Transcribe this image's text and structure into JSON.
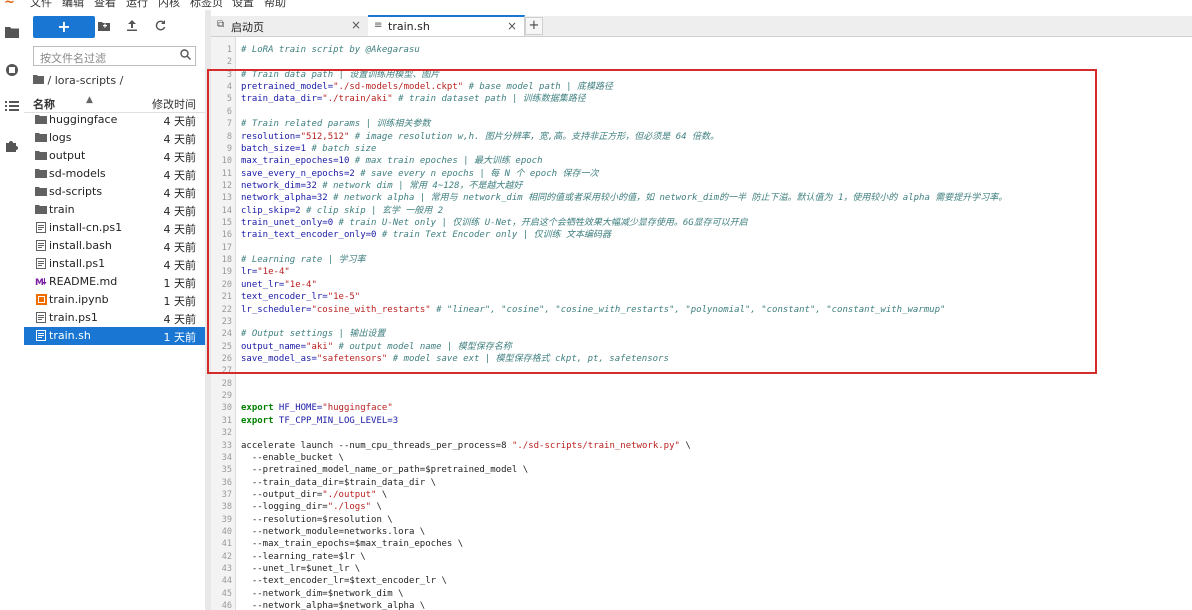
{
  "menu": [
    "文件",
    "编辑",
    "查看",
    "运行",
    "内核",
    "标签页",
    "设置",
    "帮助"
  ],
  "toolbar": {
    "new_label": "+"
  },
  "filter": {
    "placeholder": "按文件名过滤"
  },
  "breadcrumb": "/ lora-scripts /",
  "list_header": {
    "name": "名称",
    "modified": "修改时间"
  },
  "files": [
    {
      "name": "huggingface",
      "date": "4 天前",
      "kind": "folder"
    },
    {
      "name": "logs",
      "date": "4 天前",
      "kind": "folder"
    },
    {
      "name": "output",
      "date": "4 天前",
      "kind": "folder"
    },
    {
      "name": "sd-models",
      "date": "4 天前",
      "kind": "folder"
    },
    {
      "name": "sd-scripts",
      "date": "4 天前",
      "kind": "folder"
    },
    {
      "name": "train",
      "date": "4 天前",
      "kind": "folder"
    },
    {
      "name": "install-cn.ps1",
      "date": "4 天前",
      "kind": "file"
    },
    {
      "name": "install.bash",
      "date": "4 天前",
      "kind": "file"
    },
    {
      "name": "install.ps1",
      "date": "4 天前",
      "kind": "file"
    },
    {
      "name": "README.md",
      "date": "1 天前",
      "kind": "markdown"
    },
    {
      "name": "train.ipynb",
      "date": "1 天前",
      "kind": "notebook"
    },
    {
      "name": "train.ps1",
      "date": "4 天前",
      "kind": "file"
    },
    {
      "name": "train.sh",
      "date": "1 天前",
      "kind": "file",
      "selected": true
    }
  ],
  "tabs": [
    {
      "label": "启动页",
      "icon": "launcher-icon",
      "active": false
    },
    {
      "label": "train.sh",
      "icon": "text-file-icon",
      "active": true
    }
  ],
  "highlight_color": "#d62b2b",
  "accent_color": "#1976d2",
  "code_lines": [
    [
      [
        "cmt",
        "# LoRA train script by @Akegarasu"
      ]
    ],
    [],
    [
      [
        "cmt",
        "# Train data path | 设置训练用模型、图片"
      ]
    ],
    [
      [
        "var",
        "pretrained_model="
      ],
      [
        "str",
        "\"./sd-models/model.ckpt\""
      ],
      [
        "cmt",
        " # base model path | 底模路径"
      ]
    ],
    [
      [
        "var",
        "train_data_dir="
      ],
      [
        "str",
        "\"./train/aki\""
      ],
      [
        "cmt",
        " # train dataset path | 训练数据集路径"
      ]
    ],
    [],
    [
      [
        "cmt",
        "# Train related params | 训练相关参数"
      ]
    ],
    [
      [
        "var",
        "resolution="
      ],
      [
        "str",
        "\"512,512\""
      ],
      [
        "cmt",
        " # image resolution w,h. 图片分辨率，宽,高。支持非正方形，但必须是 64 倍数。"
      ]
    ],
    [
      [
        "var",
        "batch_size=1"
      ],
      [
        "cmt",
        " # batch size"
      ]
    ],
    [
      [
        "var",
        "max_train_epoches=10"
      ],
      [
        "cmt",
        " # max train epoches | 最大训练 epoch"
      ]
    ],
    [
      [
        "var",
        "save_every_n_epochs=2"
      ],
      [
        "cmt",
        " # save every n epochs | 每 N 个 epoch 保存一次"
      ]
    ],
    [
      [
        "var",
        "network_dim=32"
      ],
      [
        "cmt",
        " # network dim | 常用 4~128，不是越大越好"
      ]
    ],
    [
      [
        "var",
        "network_alpha=32"
      ],
      [
        "cmt",
        " # network alpha | 常用与 network_dim 相同的值或者采用较小的值，如 network_dim的一半 防止下溢。默认值为 1，使用较小的 alpha 需要提升学习率。"
      ]
    ],
    [
      [
        "var",
        "clip_skip=2"
      ],
      [
        "cmt",
        " # clip skip | 玄学 一般用 2"
      ]
    ],
    [
      [
        "var",
        "train_unet_only=0"
      ],
      [
        "cmt",
        " # train U-Net only | 仅训练 U-Net，开启这个会牺牲效果大幅减少显存使用。6G显存可以开启"
      ]
    ],
    [
      [
        "var",
        "train_text_encoder_only=0"
      ],
      [
        "cmt",
        " # train Text Encoder only | 仅训练 文本编码器"
      ]
    ],
    [],
    [
      [
        "cmt",
        "# Learning rate | 学习率"
      ]
    ],
    [
      [
        "var",
        "lr="
      ],
      [
        "str",
        "\"1e-4\""
      ]
    ],
    [
      [
        "var",
        "unet_lr="
      ],
      [
        "str",
        "\"1e-4\""
      ]
    ],
    [
      [
        "var",
        "text_encoder_lr="
      ],
      [
        "str",
        "\"1e-5\""
      ]
    ],
    [
      [
        "var",
        "lr_scheduler="
      ],
      [
        "str",
        "\"cosine_with_restarts\""
      ],
      [
        "cmt",
        " # \"linear\", \"cosine\", \"cosine_with_restarts\", \"polynomial\", \"constant\", \"constant_with_warmup\""
      ]
    ],
    [],
    [
      [
        "cmt",
        "# Output settings | 输出设置"
      ]
    ],
    [
      [
        "var",
        "output_name="
      ],
      [
        "str",
        "\"aki\""
      ],
      [
        "cmt",
        " # output model name | 模型保存名称"
      ]
    ],
    [
      [
        "var",
        "save_model_as="
      ],
      [
        "str",
        "\"safetensors\""
      ],
      [
        "cmt",
        " # model save ext | 模型保存格式 ckpt, pt, safetensors"
      ]
    ],
    [],
    [],
    [],
    [
      [
        "kw",
        "export"
      ],
      [
        "var",
        " HF_HOME="
      ],
      [
        "str",
        "\"huggingface\""
      ]
    ],
    [
      [
        "kw",
        "export"
      ],
      [
        "var",
        " TF_CPP_MIN_LOG_LEVEL=3"
      ]
    ],
    [],
    [
      [
        "plain",
        "accelerate launch --num_cpu_threads_per_process=8 "
      ],
      [
        "str",
        "\"./sd-scripts/train_network.py\""
      ],
      [
        "plain",
        " \\"
      ]
    ],
    [
      [
        "plain",
        "  --enable_bucket \\"
      ]
    ],
    [
      [
        "plain",
        "  --pretrained_model_name_or_path=$pretrained_model \\"
      ]
    ],
    [
      [
        "plain",
        "  --train_data_dir=$train_data_dir \\"
      ]
    ],
    [
      [
        "plain",
        "  --output_dir="
      ],
      [
        "str",
        "\"./output\""
      ],
      [
        "plain",
        " \\"
      ]
    ],
    [
      [
        "plain",
        "  --logging_dir="
      ],
      [
        "str",
        "\"./logs\""
      ],
      [
        "plain",
        " \\"
      ]
    ],
    [
      [
        "plain",
        "  --resolution=$resolution \\"
      ]
    ],
    [
      [
        "plain",
        "  --network_module=networks.lora \\"
      ]
    ],
    [
      [
        "plain",
        "  --max_train_epochs=$max_train_epoches \\"
      ]
    ],
    [
      [
        "plain",
        "  --learning_rate=$lr \\"
      ]
    ],
    [
      [
        "plain",
        "  --unet_lr=$unet_lr \\"
      ]
    ],
    [
      [
        "plain",
        "  --text_encoder_lr=$text_encoder_lr \\"
      ]
    ],
    [
      [
        "plain",
        "  --network_dim=$network_dim \\"
      ]
    ],
    [
      [
        "plain",
        "  --network_alpha=$network_alpha \\"
      ]
    ]
  ]
}
